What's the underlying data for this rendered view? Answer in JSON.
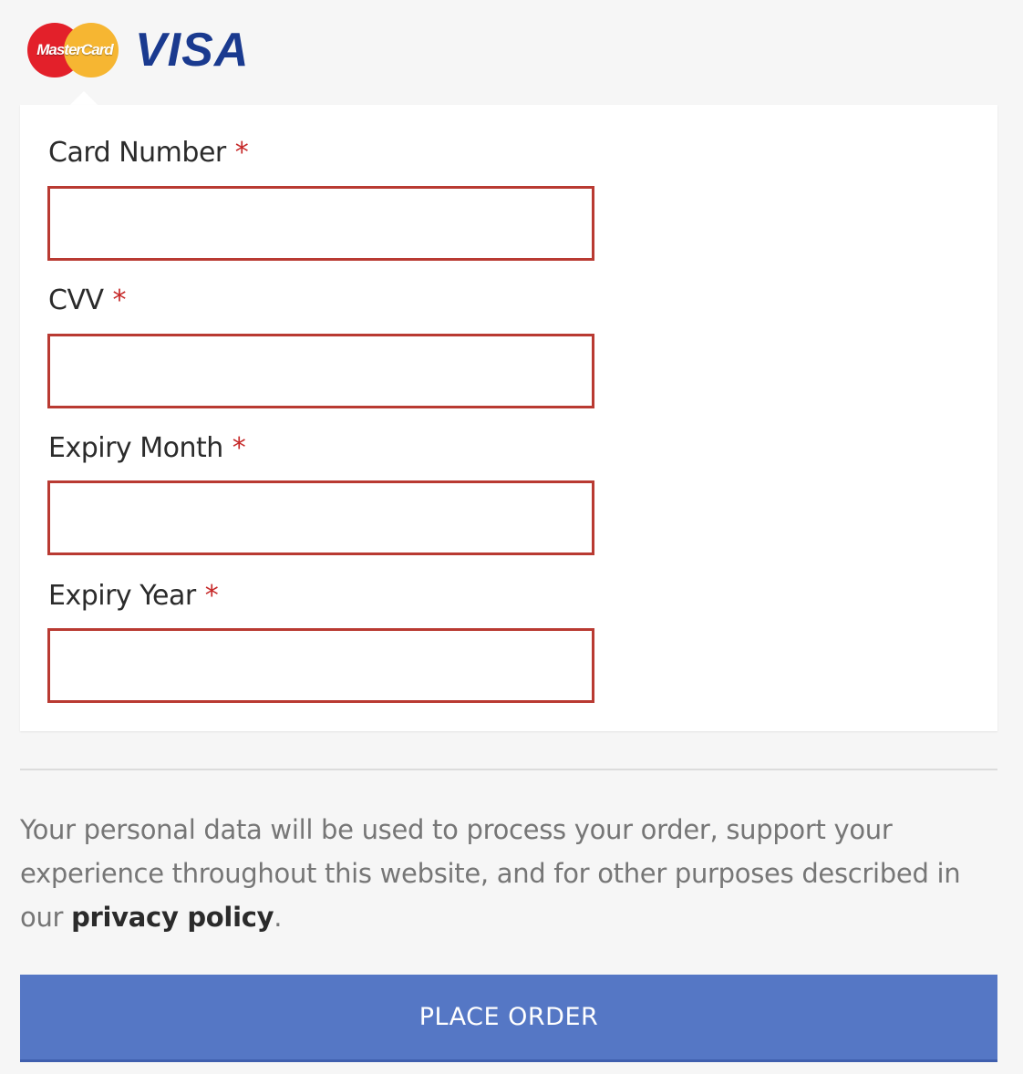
{
  "logos": {
    "mastercard_text": "MasterCard",
    "visa_text": "VISA"
  },
  "form": {
    "required_marker": "*",
    "fields": [
      {
        "label": "Card Number",
        "value": "",
        "placeholder": ""
      },
      {
        "label": "CVV",
        "value": "",
        "placeholder": ""
      },
      {
        "label": "Expiry Month",
        "value": "",
        "placeholder": ""
      },
      {
        "label": "Expiry Year",
        "value": "",
        "placeholder": ""
      }
    ]
  },
  "privacy": {
    "text_before": "Your personal data will be used to process your order, support your experience throughout this website, and for other purposes described in our ",
    "link_text": "privacy policy",
    "text_after": "."
  },
  "actions": {
    "place_order_label": "PLACE ORDER"
  },
  "colors": {
    "error_border": "#b93a32",
    "required": "#c62828",
    "button": "#5577c5",
    "visa_blue": "#1a3a8f",
    "mastercard_red": "#e3202a",
    "mastercard_yellow": "#f6b632"
  }
}
